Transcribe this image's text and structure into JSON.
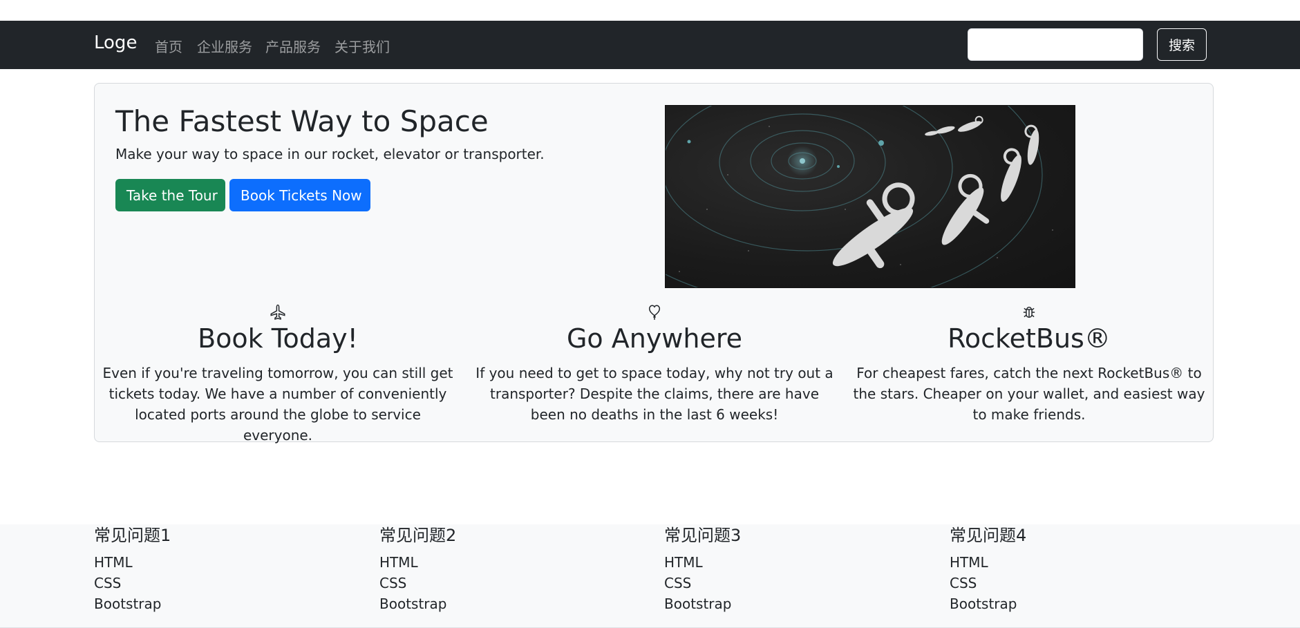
{
  "navbar": {
    "brand": "Loge",
    "links": [
      "首页",
      "企业服务",
      "产品服务",
      "关于我们"
    ],
    "search_value": "",
    "search_button": "搜索"
  },
  "hero": {
    "title": "The Fastest Way to Space",
    "subtitle": "Make your way to space in our rocket, elevator or transporter.",
    "tour_button": "Take the Tour",
    "book_button": "Book Tickets Now"
  },
  "features": [
    {
      "icon": "airplane-icon",
      "title": "Book Today!",
      "text": "Even if you're traveling tomorrow, you can still get tickets today. We have a number of conveniently located ports around the globe to service everyone."
    },
    {
      "icon": "balloon-heart-icon",
      "title": "Go Anywhere",
      "text": "If you need to get to space today, why not try out a transporter? Despite the claims, there are have been no deaths in the last 6 weeks!"
    },
    {
      "icon": "bug-icon",
      "title": "RocketBus®",
      "text": "For cheapest fares, catch the next RocketBus® to the stars. Cheaper on your wallet, and easiest way to make friends."
    }
  ],
  "footer": {
    "columns": [
      {
        "title": "常见问题1",
        "items": [
          "HTML",
          "CSS",
          "Bootstrap"
        ]
      },
      {
        "title": "常见问题2",
        "items": [
          "HTML",
          "CSS",
          "Bootstrap"
        ]
      },
      {
        "title": "常见问题3",
        "items": [
          "HTML",
          "CSS",
          "Bootstrap"
        ]
      },
      {
        "title": "常见问题4",
        "items": [
          "HTML",
          "CSS",
          "Bootstrap"
        ]
      }
    ]
  },
  "colors": {
    "navbar_bg": "#212529",
    "success": "#198754",
    "primary": "#0d6efd",
    "card_bg": "#f8f9fa"
  }
}
